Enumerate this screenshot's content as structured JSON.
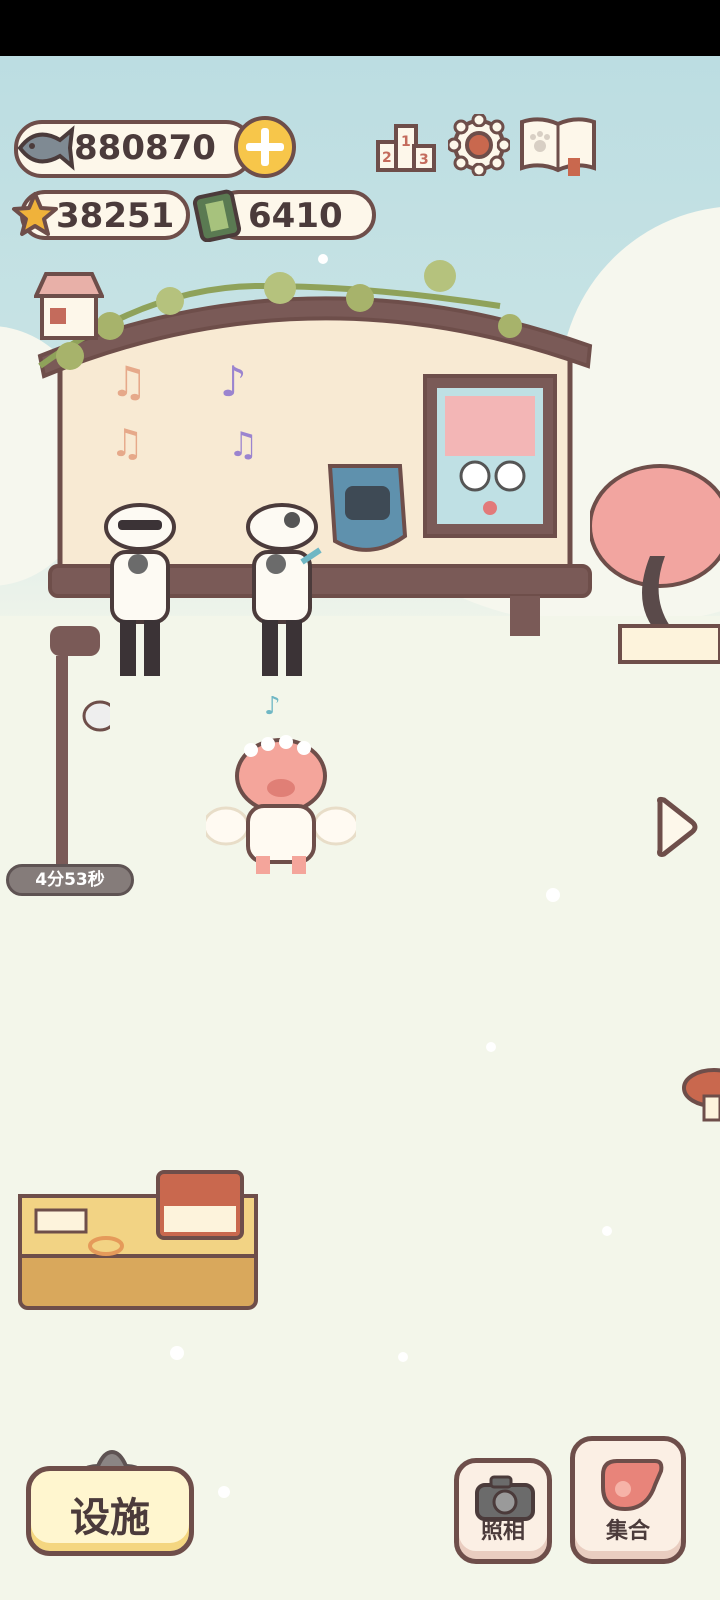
{
  "hud": {
    "fish_count": "880870",
    "star_count": "38251",
    "battery_count": "6410",
    "add_icon": "plus-icon",
    "ranking_icon": "podium-icon",
    "settings_icon": "gear-icon",
    "book_icon": "paw-book-icon"
  },
  "timer": {
    "label": "4分53秒"
  },
  "bottom": {
    "facility_label": "设施",
    "photo_label": "照相",
    "gather_label": "集合"
  },
  "colors": {
    "accent": "#f7c64a",
    "outline": "#6e4e4a",
    "cream": "#fdf7ea"
  }
}
